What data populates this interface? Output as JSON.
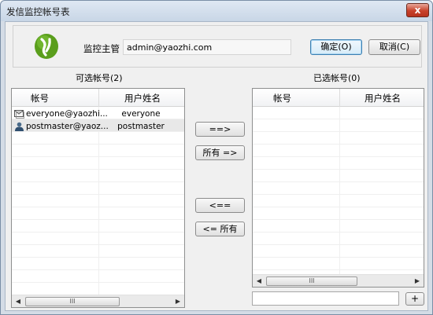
{
  "window": {
    "title": "发信监控帐号表",
    "close_glyph": "x"
  },
  "header": {
    "supervisor_label": "监控主管",
    "supervisor_value": "admin@yaozhi.com",
    "ok_label": "确定(O)",
    "cancel_label": "取消(C)"
  },
  "available": {
    "title": "可选帐号(2)",
    "columns": [
      "帐号",
      "用户姓名"
    ],
    "rows": [
      {
        "icon": "group-mail-icon",
        "account": "everyone@yaozhi...",
        "name": "everyone"
      },
      {
        "icon": "user-icon",
        "account": "postmaster@yaoz...",
        "name": "postmaster"
      }
    ],
    "scroll_grip": "III"
  },
  "transfer": {
    "add_label": "==>",
    "add_all_label": "所有 =>",
    "remove_label": "<==",
    "remove_all_label": "<= 所有"
  },
  "selected": {
    "title": "已选帐号(0)",
    "columns": [
      "帐号",
      "用户姓名"
    ],
    "rows": [],
    "scroll_grip": "III",
    "filter_value": "",
    "plus_label": "+"
  },
  "colors": {
    "logo_green": "#5a9e1c",
    "selected_row": "#e8e8e8"
  }
}
